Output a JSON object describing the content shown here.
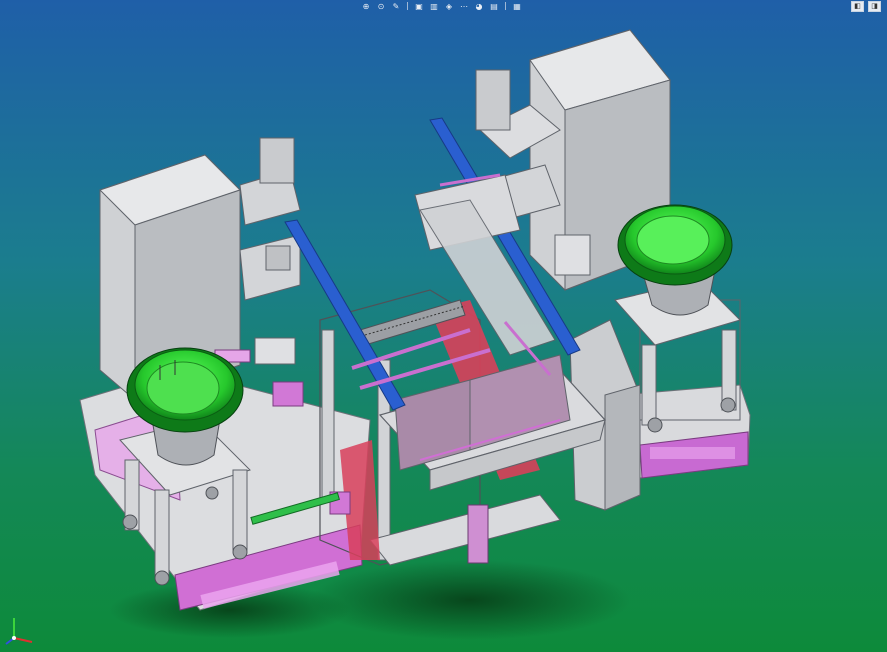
{
  "hud_toolbar": {
    "tools": [
      {
        "icon": "zoom-to-fit-icon",
        "glyph": "⊕"
      },
      {
        "icon": "zoom-area-icon",
        "glyph": "⊙"
      },
      {
        "icon": "pan-icon",
        "glyph": "✎"
      },
      {
        "icon": "view-orientation-icon",
        "glyph": "▣"
      },
      {
        "icon": "section-view-icon",
        "glyph": "▥"
      },
      {
        "icon": "display-style-icon",
        "glyph": "◈"
      },
      {
        "icon": "hide-show-icon",
        "glyph": "⋯"
      },
      {
        "icon": "appearance-icon",
        "glyph": "◕"
      },
      {
        "icon": "scene-icon",
        "glyph": "▤"
      },
      {
        "icon": "view-settings-icon",
        "glyph": "▦"
      }
    ]
  },
  "window_controls": {
    "restore_glyph": "◧",
    "maximize_glyph": "◨"
  },
  "colors": {
    "bg_top": "#1f5fa8",
    "bg_bottom": "#0d8a3a",
    "housing_grey": "#d7d9dc",
    "bowl_green": "#2fd13a",
    "rail_blue": "#2a5fd0",
    "accent_pink": "#d67ad8",
    "rail_red": "#d8405a"
  }
}
